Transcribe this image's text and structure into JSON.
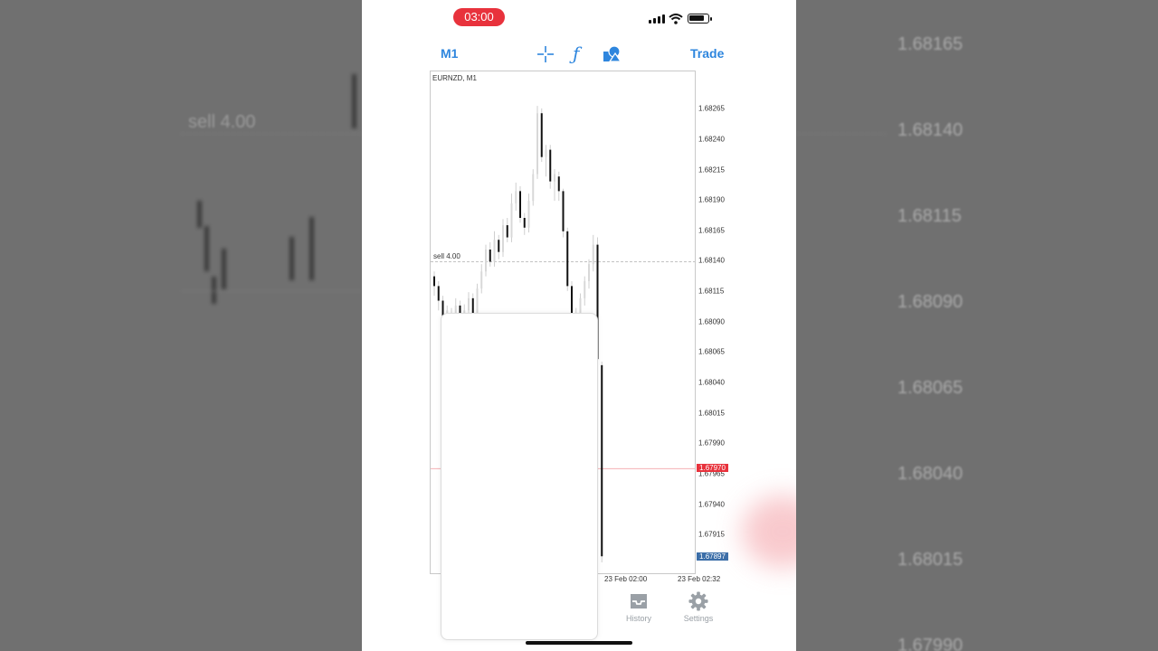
{
  "status_bar": {
    "time": "03:00"
  },
  "toolbar": {
    "timeframe": "M1",
    "crosshair_icon": "crosshair-icon",
    "indicators_icon": "function-icon",
    "objects_icon": "shapes-icon",
    "trade_label": "Trade"
  },
  "chart": {
    "symbol_label": "EURNZD, M1",
    "sell_label": "sell 4.00",
    "y_ticks": [
      "1.68265",
      "1.68240",
      "1.68215",
      "1.68190",
      "1.68165",
      "1.68140",
      "1.68115",
      "1.68090",
      "1.68065",
      "1.68040",
      "1.68015",
      "1.67990",
      "1.67965",
      "1.67940",
      "1.67915"
    ],
    "bid_badge": "1.67970",
    "ask_badge": "1.67897",
    "x_labels": [
      "23 Feb 02:00",
      "23 Feb 02:32"
    ],
    "colors": {
      "bid": "#e8323c",
      "ask": "#3b6ea8",
      "candle": "#111111",
      "wick": "#cfcfcf"
    }
  },
  "chart_data": {
    "type": "candlestick",
    "symbol": "EURNZD",
    "timeframe": "M1",
    "ylim": [
      1.6789,
      1.6828
    ],
    "sell_level": 1.6814,
    "bid": 1.6797,
    "ask": 1.67897,
    "candles": [
      {
        "o": 1.68128,
        "c": 1.6812,
        "h": 1.68132,
        "l": 1.68112
      },
      {
        "o": 1.6812,
        "c": 1.68108,
        "h": 1.68124,
        "l": 1.681
      },
      {
        "o": 1.68108,
        "c": 1.68095,
        "h": 1.68112,
        "l": 1.68088
      },
      {
        "o": 1.68095,
        "c": 1.681,
        "h": 1.68104,
        "l": 1.68088
      },
      {
        "o": 1.68098,
        "c": 1.68092,
        "h": 1.68102,
        "l": 1.68086
      },
      {
        "o": 1.68092,
        "c": 1.68104,
        "h": 1.6811,
        "l": 1.68088
      },
      {
        "o": 1.68104,
        "c": 1.68094,
        "h": 1.68108,
        "l": 1.6809
      },
      {
        "o": 1.68094,
        "c": 1.681,
        "h": 1.68105,
        "l": 1.6809
      },
      {
        "o": 1.681,
        "c": 1.6811,
        "h": 1.68115,
        "l": 1.68096
      },
      {
        "o": 1.6811,
        "c": 1.68098,
        "h": 1.68114,
        "l": 1.68094
      },
      {
        "o": 1.68098,
        "c": 1.68118,
        "h": 1.68122,
        "l": 1.68094
      },
      {
        "o": 1.68118,
        "c": 1.68132,
        "h": 1.68138,
        "l": 1.68114
      },
      {
        "o": 1.68132,
        "c": 1.6815,
        "h": 1.68154,
        "l": 1.68128
      },
      {
        "o": 1.6815,
        "c": 1.6814,
        "h": 1.68156,
        "l": 1.68136
      },
      {
        "o": 1.6814,
        "c": 1.68158,
        "h": 1.68165,
        "l": 1.68136
      },
      {
        "o": 1.68158,
        "c": 1.68148,
        "h": 1.68162,
        "l": 1.68142
      },
      {
        "o": 1.68148,
        "c": 1.6817,
        "h": 1.68175,
        "l": 1.68144
      },
      {
        "o": 1.6817,
        "c": 1.6816,
        "h": 1.68176,
        "l": 1.68156
      },
      {
        "o": 1.6816,
        "c": 1.68188,
        "h": 1.68196,
        "l": 1.68156
      },
      {
        "o": 1.68188,
        "c": 1.68198,
        "h": 1.68205,
        "l": 1.68182
      },
      {
        "o": 1.68198,
        "c": 1.68176,
        "h": 1.68202,
        "l": 1.68172
      },
      {
        "o": 1.68176,
        "c": 1.68168,
        "h": 1.6818,
        "l": 1.68162
      },
      {
        "o": 1.68168,
        "c": 1.6819,
        "h": 1.68196,
        "l": 1.68164
      },
      {
        "o": 1.6819,
        "c": 1.68212,
        "h": 1.68216,
        "l": 1.68186
      },
      {
        "o": 1.68212,
        "c": 1.68262,
        "h": 1.68268,
        "l": 1.68208
      },
      {
        "o": 1.68262,
        "c": 1.68226,
        "h": 1.68266,
        "l": 1.68222
      },
      {
        "o": 1.68226,
        "c": 1.68232,
        "h": 1.68236,
        "l": 1.6821
      },
      {
        "o": 1.68232,
        "c": 1.68206,
        "h": 1.68236,
        "l": 1.682
      },
      {
        "o": 1.68206,
        "c": 1.68212,
        "h": 1.68216,
        "l": 1.6819
      },
      {
        "o": 1.6821,
        "c": 1.68198,
        "h": 1.68214,
        "l": 1.6819
      },
      {
        "o": 1.68198,
        "c": 1.68165,
        "h": 1.682,
        "l": 1.6816
      },
      {
        "o": 1.68165,
        "c": 1.6812,
        "h": 1.68168,
        "l": 1.68116
      },
      {
        "o": 1.6812,
        "c": 1.68098,
        "h": 1.68124,
        "l": 1.68092
      },
      {
        "o": 1.68098,
        "c": 1.68094,
        "h": 1.68102,
        "l": 1.6809
      },
      {
        "o": 1.68094,
        "c": 1.6811,
        "h": 1.68114,
        "l": 1.6809
      },
      {
        "o": 1.6811,
        "c": 1.68124,
        "h": 1.68128,
        "l": 1.68104
      },
      {
        "o": 1.68124,
        "c": 1.68138,
        "h": 1.68142,
        "l": 1.68118
      },
      {
        "o": 1.68138,
        "c": 1.68154,
        "h": 1.68162,
        "l": 1.68132
      },
      {
        "o": 1.68154,
        "c": 1.6806,
        "h": 1.6816,
        "l": 1.68056
      },
      {
        "o": 1.68055,
        "c": 1.67898,
        "h": 1.68058,
        "l": 1.67893
      }
    ]
  },
  "tabbar": {
    "history_label": "History",
    "settings_label": "Settings"
  },
  "background": {
    "prices": [
      "1.68165",
      "1.68140",
      "1.68115",
      "1.68090",
      "1.68065",
      "1.68040",
      "1.68015",
      "1.67990"
    ],
    "sell_label": "sell 4.00"
  }
}
